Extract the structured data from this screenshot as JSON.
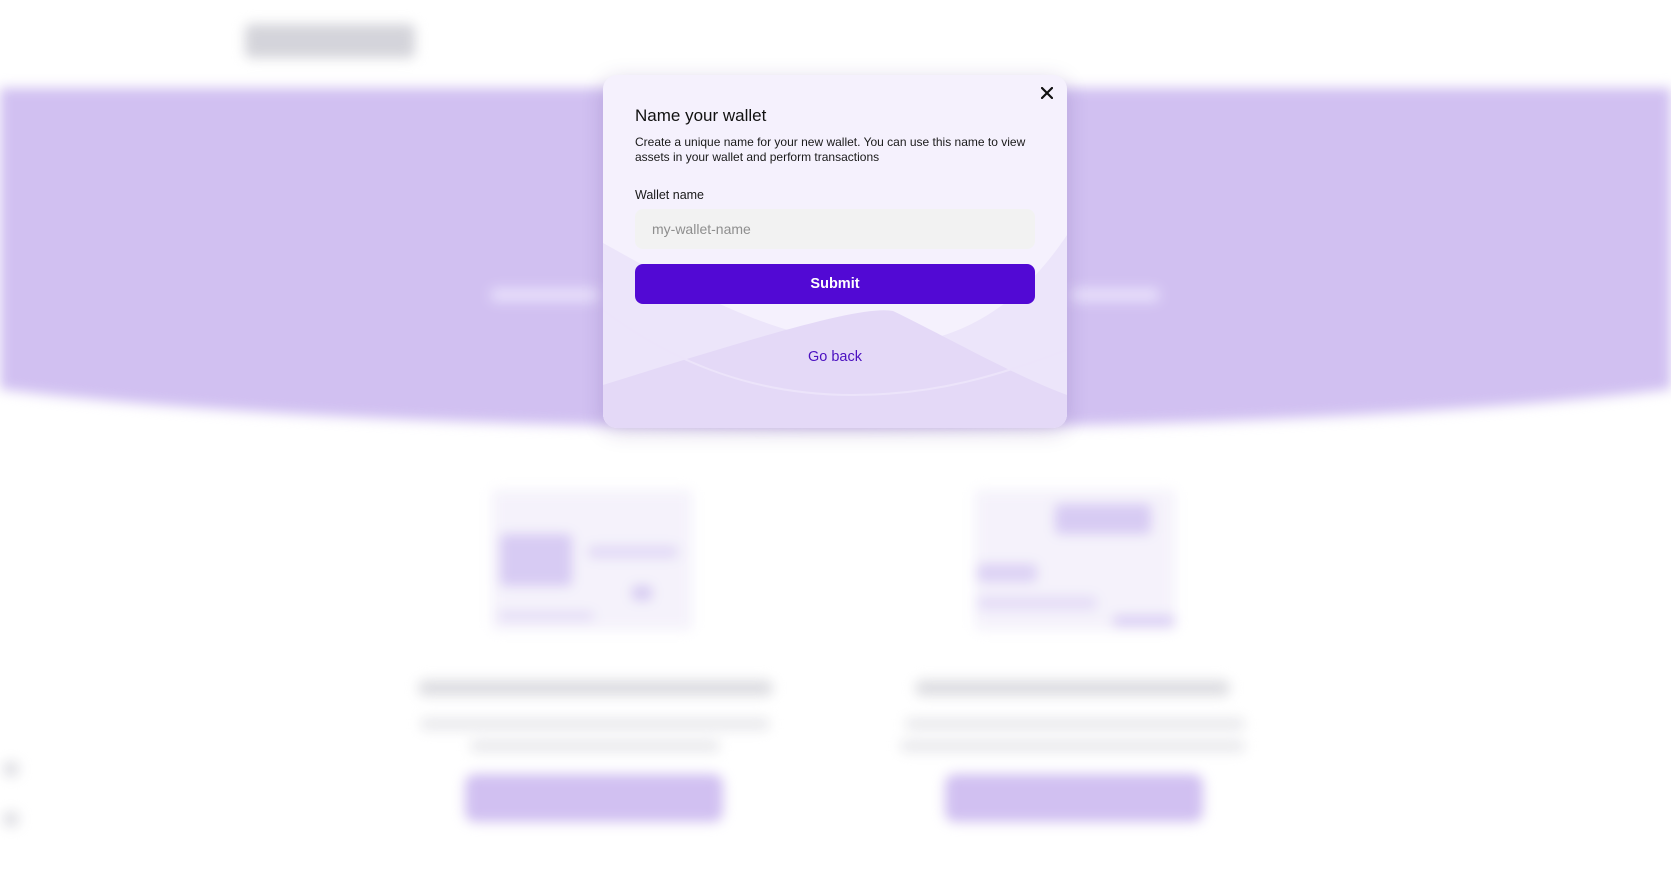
{
  "modal": {
    "close_icon": "close-icon",
    "title": "Name your wallet",
    "description": "Create a unique name for your new wallet. You can use this name to view assets in your wallet and perform transactions",
    "field_label": "Wallet name",
    "input_value": "",
    "input_placeholder": "my-wallet-name",
    "submit_label": "Submit",
    "go_back_label": "Go back"
  },
  "colors": {
    "primary": "#5209d4",
    "link": "#4b10c0",
    "hero_background": "#cbb8f0",
    "modal_background": "#f5f1fd",
    "input_background": "#f2f2f2"
  }
}
